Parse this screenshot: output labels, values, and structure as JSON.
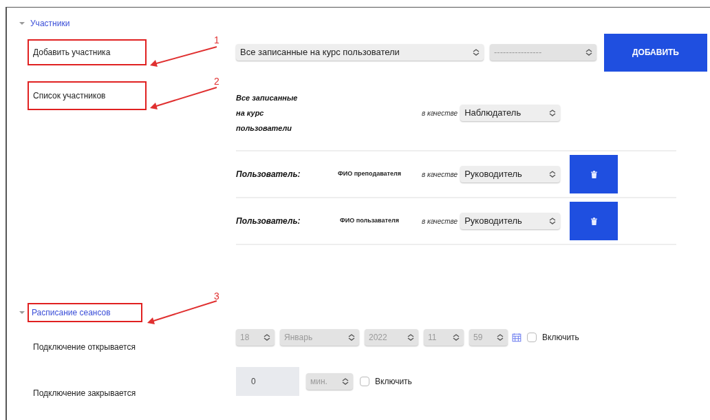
{
  "participants": {
    "title": "Участники",
    "expanded": true,
    "add_label": {
      "text": "Добавить участника",
      "highlighted": true,
      "annotation": "1"
    },
    "list_label": {
      "text": "Список участников",
      "highlighted": true,
      "annotation": "2"
    },
    "add_row": {
      "user_select": "Все записанные на курс пользователи",
      "role_select": "----------------",
      "button": "ДОБАВИТЬ"
    },
    "entries": [
      {
        "kind": "group",
        "name": "Все записанные на курс пользователи",
        "as": "в качестве",
        "role": "Наблюдатель"
      },
      {
        "kind": "user",
        "label": "Пользователь:",
        "name": "ФИО преподавателя",
        "as": "в качестве",
        "role": "Руководитель"
      },
      {
        "kind": "user",
        "label": "Пользователь:",
        "name": "ФИО пользавателя",
        "as": "в качестве",
        "role": "Руководитель"
      }
    ]
  },
  "schedule": {
    "title": "Расписание сеансов",
    "expanded": true,
    "highlighted": true,
    "annotation": "3",
    "open": {
      "label": "Подключение открывается",
      "disabled": true,
      "selects": [
        "18",
        "Январь",
        "2022",
        "11",
        "59"
      ],
      "enable": {
        "label": "Включить",
        "checked": false
      }
    },
    "close": {
      "label": "Подключение закрывается",
      "value": "0",
      "unit": "мин.",
      "disabled": true,
      "enable": {
        "label": "Включить",
        "checked": false
      }
    }
  }
}
